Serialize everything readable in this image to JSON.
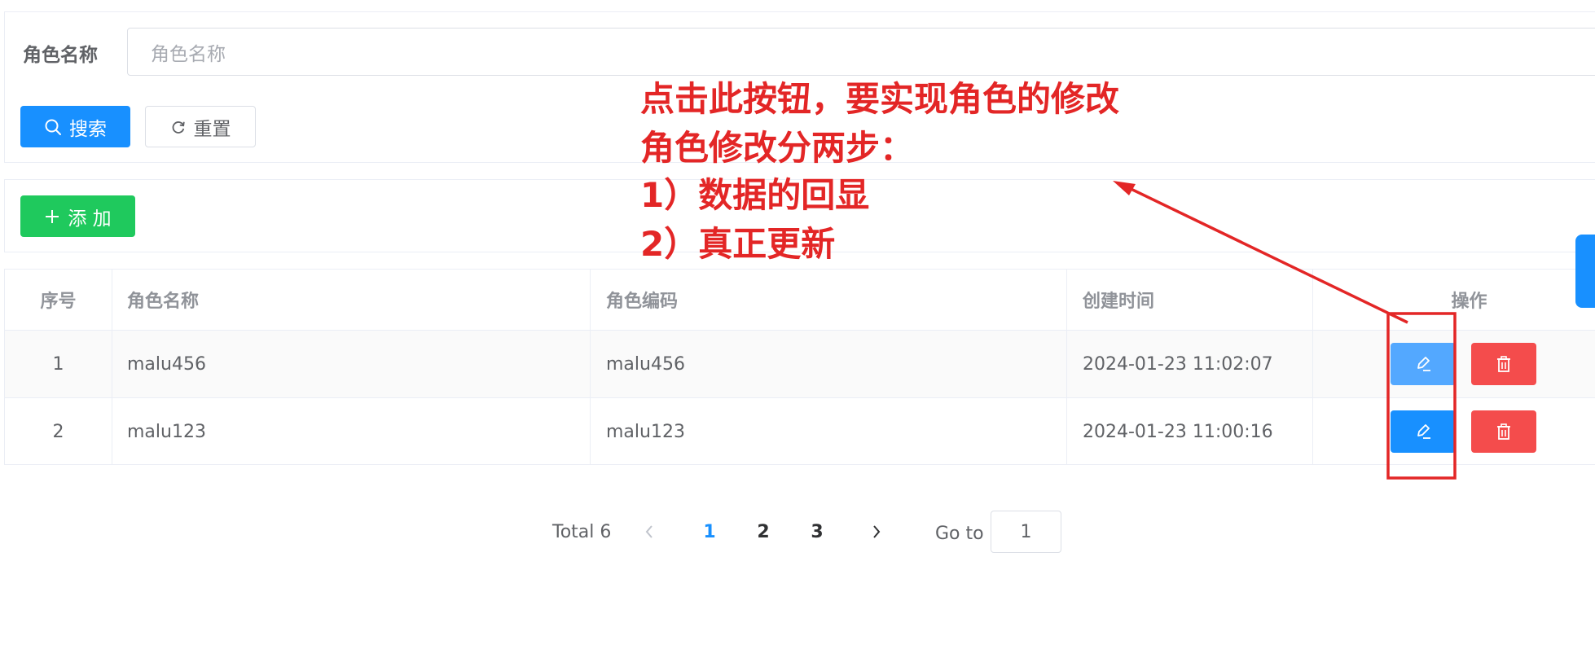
{
  "search": {
    "label": "角色名称",
    "placeholder": "角色名称",
    "search_button": "搜索",
    "reset_button": "重置"
  },
  "toolbar": {
    "add_button": "添 加"
  },
  "table": {
    "headers": [
      "序号",
      "角色名称",
      "角色编码",
      "创建时间",
      "操作"
    ],
    "rows": [
      {
        "index": "1",
        "name": "malu456",
        "code": "malu456",
        "created": "2024-01-23 11:02:07"
      },
      {
        "index": "2",
        "name": "malu123",
        "code": "malu123",
        "created": "2024-01-23 11:00:16"
      }
    ]
  },
  "pagination": {
    "total": "Total 6",
    "pages": [
      "1",
      "2",
      "3"
    ],
    "current": "1",
    "goto_label": "Go to",
    "goto_value": "1"
  },
  "annotation": {
    "lines": [
      "点击此按钮，要实现角色的修改",
      "角色修改分两步：",
      "1）数据的回显",
      "2）真正更新"
    ],
    "color": "#e32626"
  },
  "colors": {
    "primary": "#1890ff",
    "success": "#1fc95d",
    "danger": "#f44c4c"
  }
}
